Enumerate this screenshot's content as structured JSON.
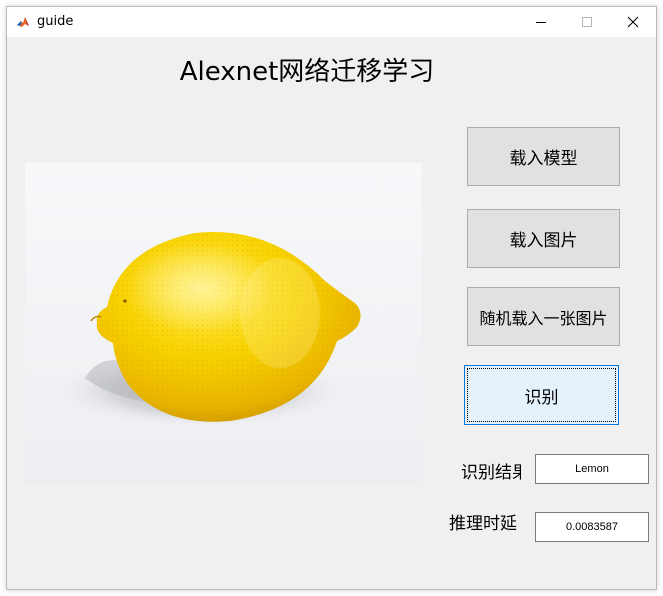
{
  "window": {
    "title": "guide"
  },
  "heading": "Alexnet网络迁移学习",
  "buttons": {
    "load_model": "载入模型",
    "load_image": "载入图片",
    "random_load": "随机载入一张图片",
    "recognize": "识别"
  },
  "result": {
    "label": "识别结果",
    "value": "Lemon"
  },
  "inference_time": {
    "label": "推理时延",
    "value": "0.0083587"
  },
  "colors": {
    "window_bg": "#f0f0f0",
    "button_bg": "#e1e1e1",
    "focused_button_bg": "#e5f1fb",
    "focused_button_border": "#0078d7",
    "lemon": "#f5c800"
  }
}
